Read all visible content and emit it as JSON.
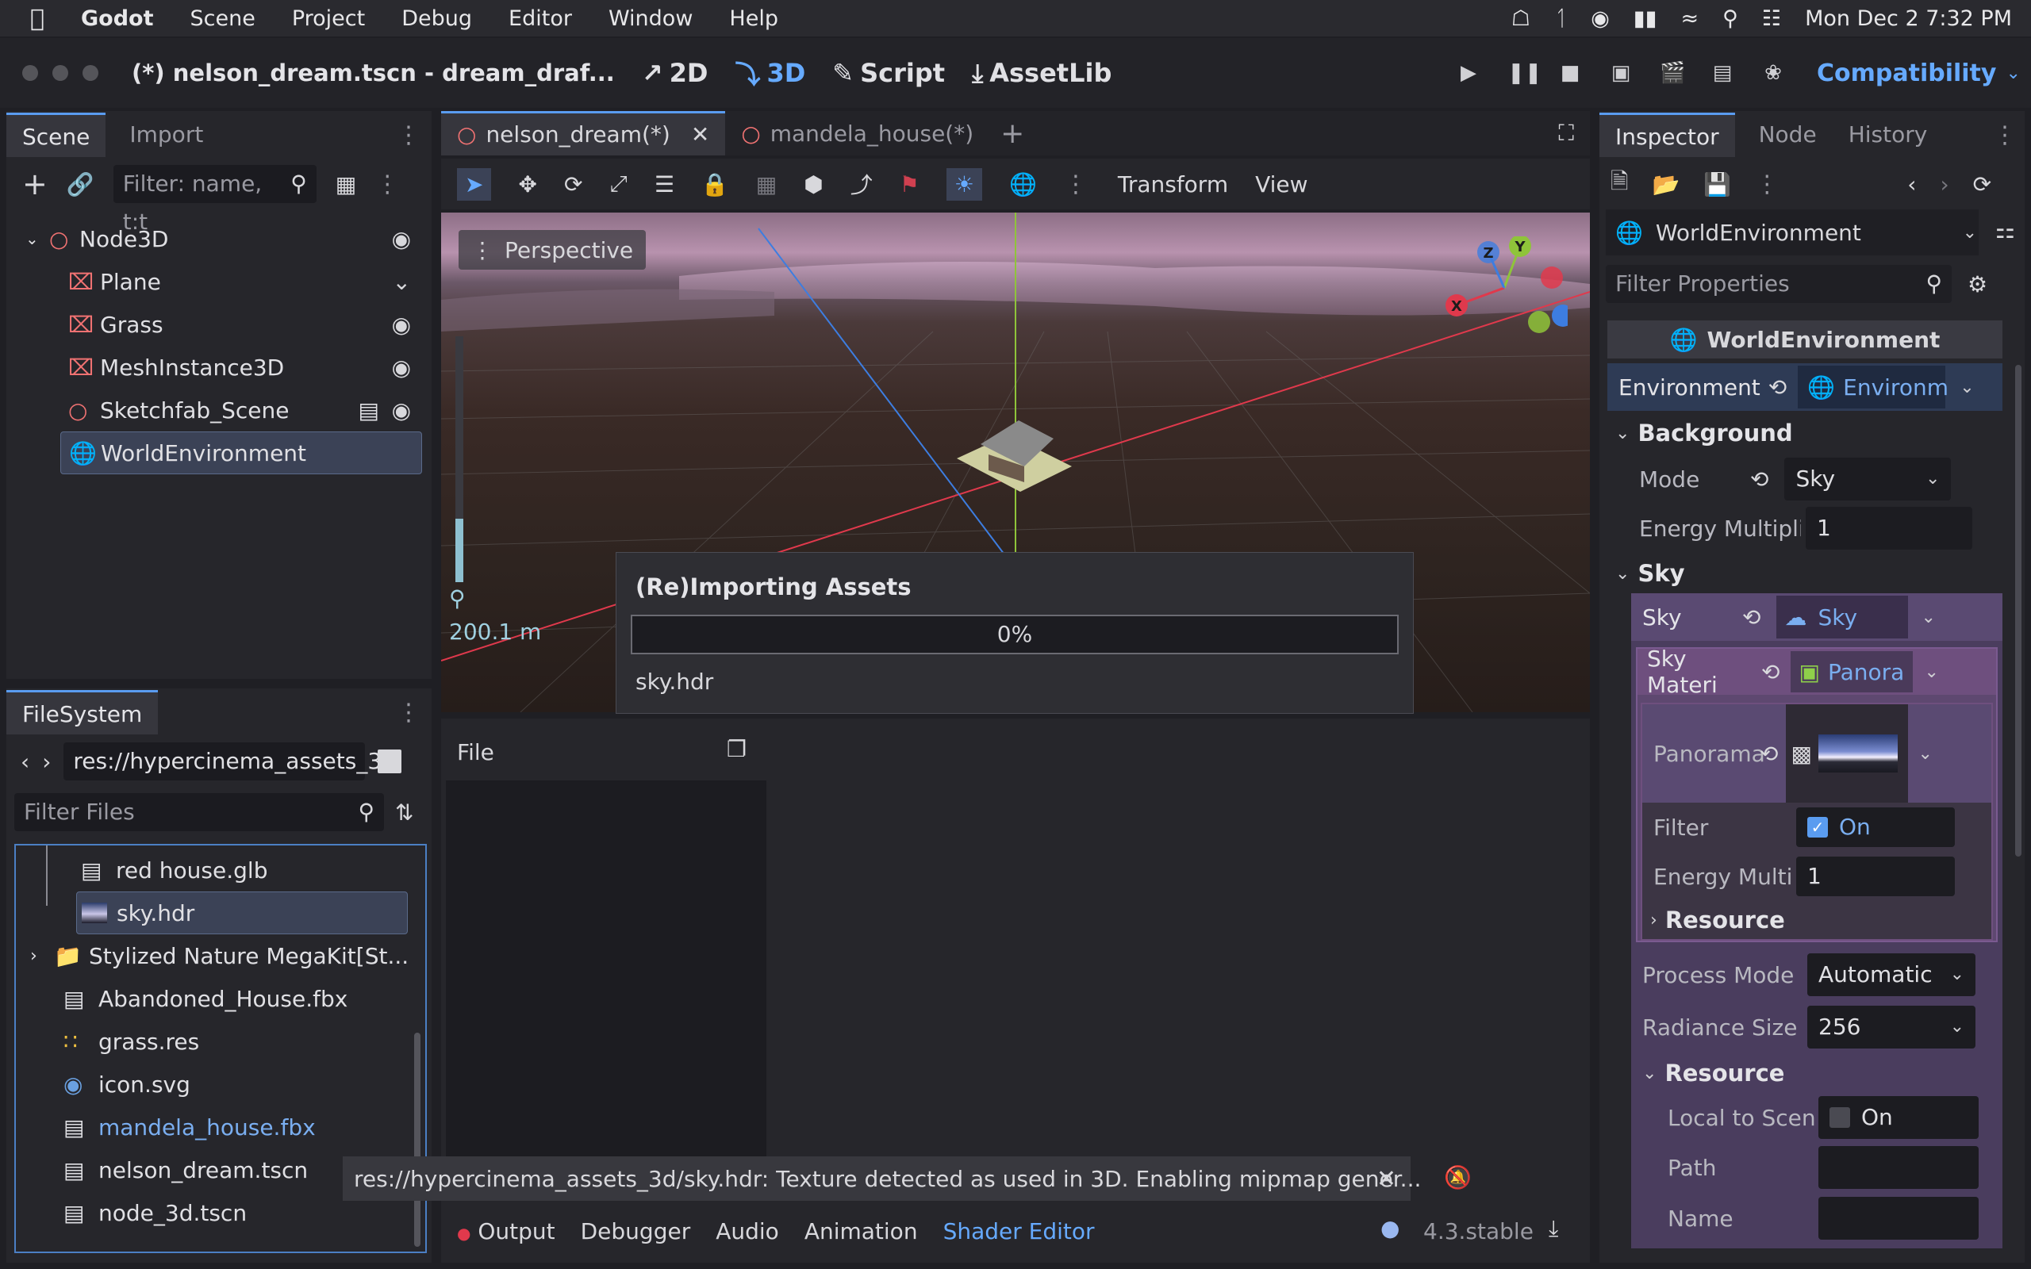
{
  "menubar": {
    "app": "Godot",
    "items": [
      "Scene",
      "Project",
      "Debug",
      "Editor",
      "Window",
      "Help"
    ],
    "clock": "Mon Dec 2  7:32 PM"
  },
  "titlebar": {
    "title": "(*) nelson_dream.tscn - dream_draf...",
    "workspaces": [
      "2D",
      "3D",
      "Script",
      "AssetLib"
    ],
    "active_workspace": "3D",
    "renderer": "Compatibility"
  },
  "scene_dock": {
    "tabs": [
      "Scene",
      "Import"
    ],
    "filter_placeholder": "Filter: name, t:t",
    "nodes": [
      {
        "name": "Node3D",
        "icon": "node3d-circle-icon"
      },
      {
        "name": "Plane",
        "icon": "mesh-instance-icon"
      },
      {
        "name": "Grass",
        "icon": "multimesh-icon"
      },
      {
        "name": "MeshInstance3D",
        "icon": "mesh-instance-icon"
      },
      {
        "name": "Sketchfab_Scene",
        "icon": "node3d-circle-icon"
      },
      {
        "name": "WorldEnvironment",
        "icon": "world-environment-icon"
      }
    ]
  },
  "filesystem": {
    "tab": "FileSystem",
    "path": "res://hypercinema_assets_3",
    "filter_placeholder": "Filter Files",
    "files": [
      {
        "name": "red house.glb",
        "icon": "scene-clapper-icon"
      },
      {
        "name": "sky.hdr",
        "icon": "image-thumbnail-icon"
      },
      {
        "name": "Stylized Nature MegaKit[St...",
        "icon": "folder-icon"
      },
      {
        "name": "Abandoned_House.fbx",
        "icon": "scene-clapper-icon"
      },
      {
        "name": "grass.res",
        "icon": "resource-dots-icon"
      },
      {
        "name": "icon.svg",
        "icon": "godot-logo-icon"
      },
      {
        "name": "mandela_house.fbx",
        "icon": "scene-clapper-icon"
      },
      {
        "name": "nelson_dream.tscn",
        "icon": "scene-clapper-icon"
      },
      {
        "name": "node_3d.tscn",
        "icon": "scene-clapper-icon"
      }
    ]
  },
  "editor_tabs": [
    "nelson_dream(*)",
    "mandela_house(*)"
  ],
  "viewport_toolbar": {
    "transform": "Transform",
    "view": "View"
  },
  "viewport": {
    "perspective": "Perspective",
    "distance": "200.1 m",
    "gizmo": {
      "x": "X",
      "y": "Y",
      "z": "Z"
    }
  },
  "import_dialog": {
    "title": "(Re)Importing Assets",
    "progress_text": "0%",
    "progress": 0,
    "file": "sky.hdr"
  },
  "bottom_panel": {
    "file_header": "File",
    "message": "res://hypercinema_assets_3d/sky.hdr: Texture detected as used in 3D. Enabling mipmap gener...",
    "tabs": [
      "Output",
      "Debugger",
      "Audio",
      "Animation",
      "Shader Editor"
    ],
    "version": "4.3.stable"
  },
  "inspector": {
    "tabs": [
      "Inspector",
      "Node",
      "History"
    ],
    "object": "WorldEnvironment",
    "filter_placeholder": "Filter Properties",
    "header": "WorldEnvironment",
    "environment_label": "Environment",
    "environment_value": "Environm",
    "background": {
      "section": "Background",
      "mode_label": "Mode",
      "mode_value": "Sky",
      "energy_label": "Energy Multipli",
      "energy_value": "1"
    },
    "sky": {
      "section": "Sky",
      "sky_label": "Sky",
      "sky_value": "Sky",
      "material_label": "Sky Materi",
      "material_value": "Panora",
      "panorama_label": "Panorama",
      "filter_label": "Filter",
      "filter_value": "On",
      "energy_label": "Energy Multi",
      "energy_value": "1",
      "resource_section": "Resource",
      "process_mode_label": "Process Mode",
      "process_mode_value": "Automatic",
      "radiance_label": "Radiance Size",
      "radiance_value": "256"
    },
    "resource": {
      "section": "Resource",
      "local_label": "Local to Scen",
      "local_value": "On",
      "path_label": "Path",
      "name_label": "Name"
    }
  },
  "colors": {
    "accent": "#66aaff",
    "sky_panel": "#5a4a72",
    "material_panel": "#6e4f7e"
  }
}
